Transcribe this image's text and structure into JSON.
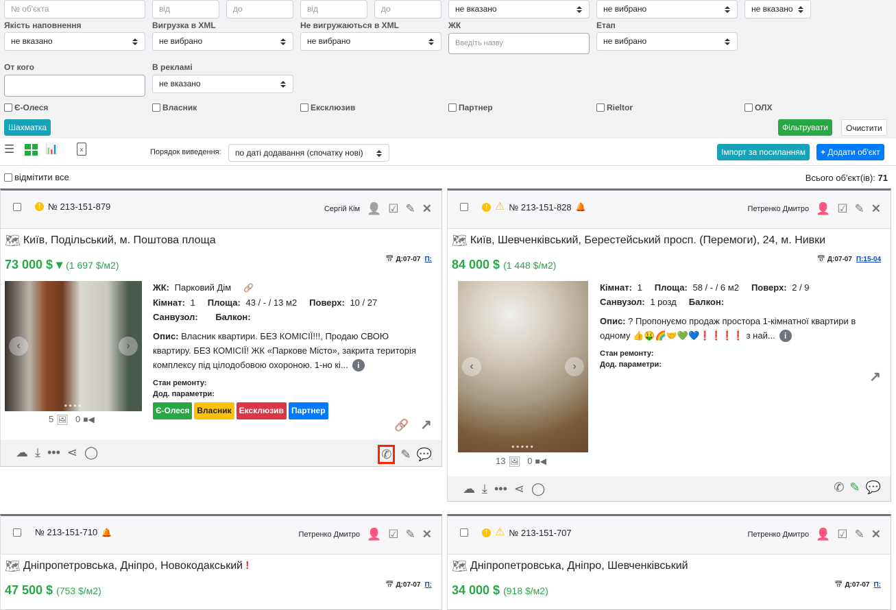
{
  "filters": {
    "row1": {
      "object_no_placeholder": "№ об'єкта",
      "from1": "від",
      "to1": "до",
      "from2": "від",
      "to2": "до",
      "sel1": "не вказано",
      "sel2": "не вибрано",
      "sel3": "не вказано"
    },
    "quality": {
      "label": "Якість наповнення",
      "value": "не вказано"
    },
    "xml": {
      "label": "Вигрузка в XML",
      "value": "не вибрано"
    },
    "not_xml": {
      "label": "Не вигружаються в XML",
      "value": "не вибрано"
    },
    "complex": {
      "label": "ЖК",
      "placeholder": "Введіть назву"
    },
    "stage": {
      "label": "Етап",
      "value": "не вибрано"
    },
    "from_whom": {
      "label": "От кого",
      "value": ""
    },
    "in_ads": {
      "label": "В рекламі",
      "value": "не вказано"
    },
    "checkboxes": [
      "Є-Олеся",
      "Власник",
      "Ексклюзив",
      "Партнер",
      "Rieltor",
      "ОЛХ"
    ],
    "chess_button": "Шахматка",
    "filter_button": "Фільтрувати",
    "clear_button": "Очистити"
  },
  "toolbar": {
    "order_label": "Порядок виведення:",
    "order_value": "по даті додавання (спочатку нові)",
    "import_button": "Імпорт за посиланням",
    "add_button": "Додати об'єкт"
  },
  "list": {
    "select_all": "відмітити все",
    "total_label": "Всього об'єкт(ів):",
    "total": "71"
  },
  "cards": [
    {
      "number": "№ 213-151-879",
      "agent": "Сергій Кім",
      "address": "Київ, Подільський, м. Поштова площа",
      "price": "73 000 $",
      "per_m2": "(1 697 $/м2)",
      "date_d": "Д:07-07",
      "date_p": "П:",
      "complex_label": "ЖК:",
      "complex": "Парковий Дім",
      "rooms_label": "Кімнат:",
      "rooms": "1",
      "area_label": "Площа:",
      "area": "43 / - / 13 м2",
      "floor_label": "Поверх:",
      "floor": "10 / 27",
      "bath_label": "Санвузол:",
      "bath": "",
      "balcony_label": "Балкон:",
      "desc_label": "Опис:",
      "desc": "Власник квартири. БЕЗ КОМІСІЇ!!!, Продаю СВОЮ квартиру. БЕЗ КОМІСІЇ! ЖК «Паркове Місто», закрита територія комплексу під цілодобовою охороною. 1-но кі...",
      "repair_label": "Стан ремонту:",
      "params_label": "Дод. параметри:",
      "photos": "5",
      "videos": "0",
      "tags": [
        {
          "label": "Є-Олеся",
          "color": "#28a745"
        },
        {
          "label": "Власник",
          "color": "#ffc107"
        },
        {
          "label": "Ексклюзив",
          "color": "#dc3545"
        },
        {
          "label": "Партнер",
          "color": "#007bff"
        }
      ]
    },
    {
      "number": "№ 213-151-828",
      "agent": "Петренко Дмитро",
      "address": "Київ, Шевченківський, Берестейський просп. (Перемоги), 24, м. Нивки",
      "price": "84 000 $",
      "per_m2": "(1 448 $/м2)",
      "date_d": "Д:07-07",
      "date_p": "П:15-04",
      "rooms_label": "Кімнат:",
      "rooms": "1",
      "area_label": "Площа:",
      "area": "58 / - / 6 м2",
      "floor_label": "Поверх:",
      "floor": "2 / 9",
      "bath_label": "Санвузол:",
      "bath": "1 розд",
      "balcony_label": "Балкон:",
      "desc_label": "Опис:",
      "desc": "? Пропонуємо продаж простора 1-кімнатної квартири в одному 👍🤑🌈🤝💚💙❗❗❗❗ з най...",
      "repair_label": "Стан ремонту:",
      "params_label": "Дод. параметри:",
      "photos": "13",
      "videos": "0"
    },
    {
      "number": "№ 213-151-710",
      "agent": "Петренко Дмитро",
      "address": "Дніпропетровська, Дніпро, Новокодакський",
      "address_mark": "!",
      "price": "47 500 $",
      "per_m2": "(753 $/м2)",
      "date_d": "Д:07-07",
      "date_p": "П:"
    },
    {
      "number": "№ 213-151-707",
      "agent": "Петренко Дмитро",
      "address": "Дніпропетровська, Дніпро, Шевченківський",
      "price": "34 000 $",
      "per_m2": "(918 $/м2)",
      "date_d": "Д:07-07",
      "date_p": "П:"
    }
  ],
  "colors": {
    "green": "#28a745",
    "teal": "#17a2b8",
    "blue": "#007bff",
    "red": "#dc3545",
    "yellow": "#ffc107",
    "highlight": "#ff2200"
  }
}
